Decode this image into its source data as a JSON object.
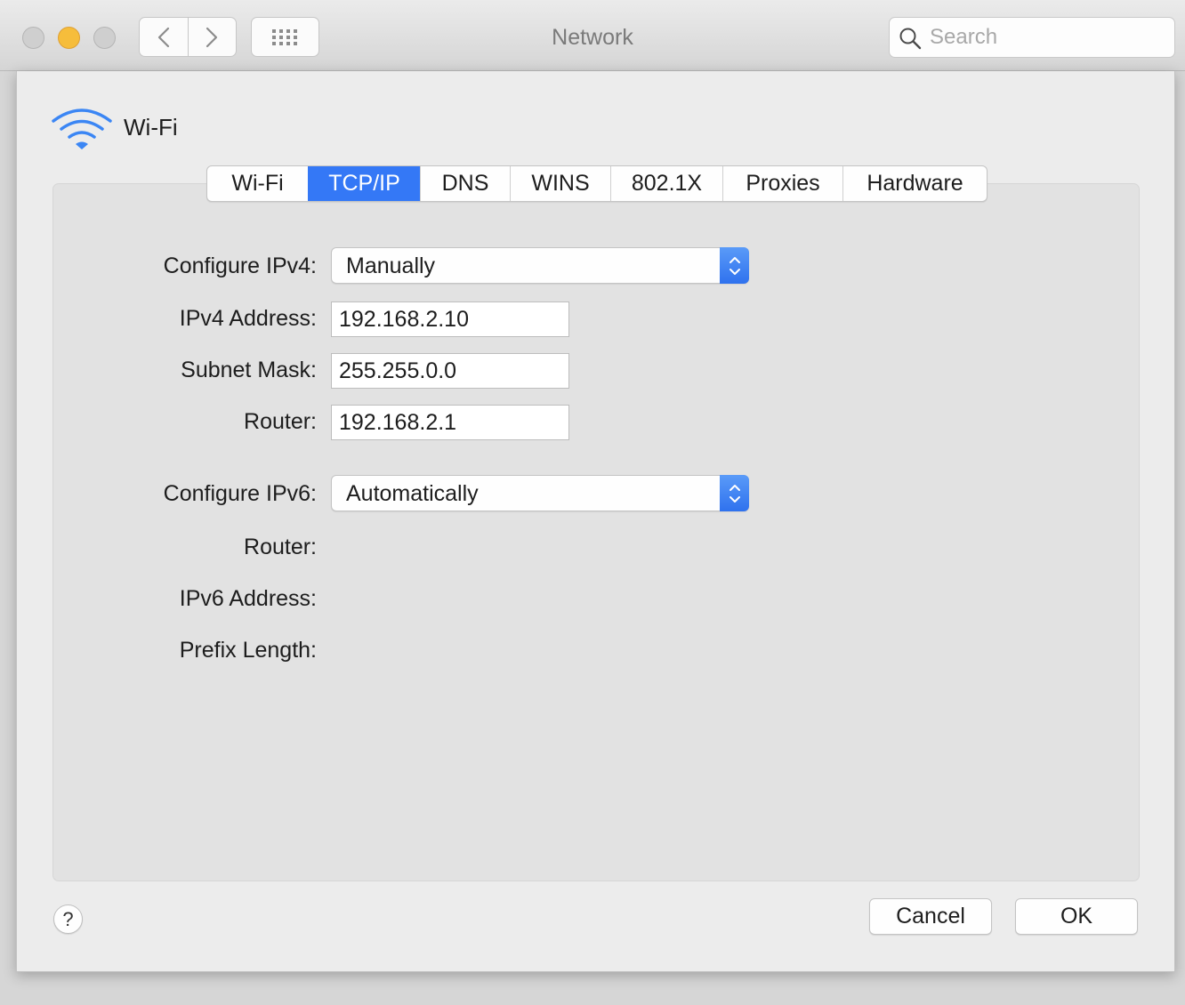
{
  "window": {
    "title": "Network",
    "search_placeholder": "Search"
  },
  "service": {
    "name": "Wi-Fi"
  },
  "tabs": [
    {
      "label": "Wi-Fi",
      "active": false
    },
    {
      "label": "TCP/IP",
      "active": true
    },
    {
      "label": "DNS",
      "active": false
    },
    {
      "label": "WINS",
      "active": false
    },
    {
      "label": "802.1X",
      "active": false
    },
    {
      "label": "Proxies",
      "active": false
    },
    {
      "label": "Hardware",
      "active": false
    }
  ],
  "ipv4": {
    "configure_label": "Configure IPv4:",
    "configure_value": "Manually",
    "address_label": "IPv4 Address:",
    "address_value": "192.168.2.10",
    "subnet_label": "Subnet Mask:",
    "subnet_value": "255.255.0.0",
    "router_label": "Router:",
    "router_value": "192.168.2.1"
  },
  "ipv6": {
    "configure_label": "Configure IPv6:",
    "configure_value": "Automatically",
    "router_label": "Router:",
    "address_label": "IPv6 Address:",
    "prefix_label": "Prefix Length:"
  },
  "buttons": {
    "help": "?",
    "cancel": "Cancel",
    "ok": "OK"
  },
  "colors": {
    "accent": "#3478f6",
    "minimize": "#f6bd3b"
  }
}
